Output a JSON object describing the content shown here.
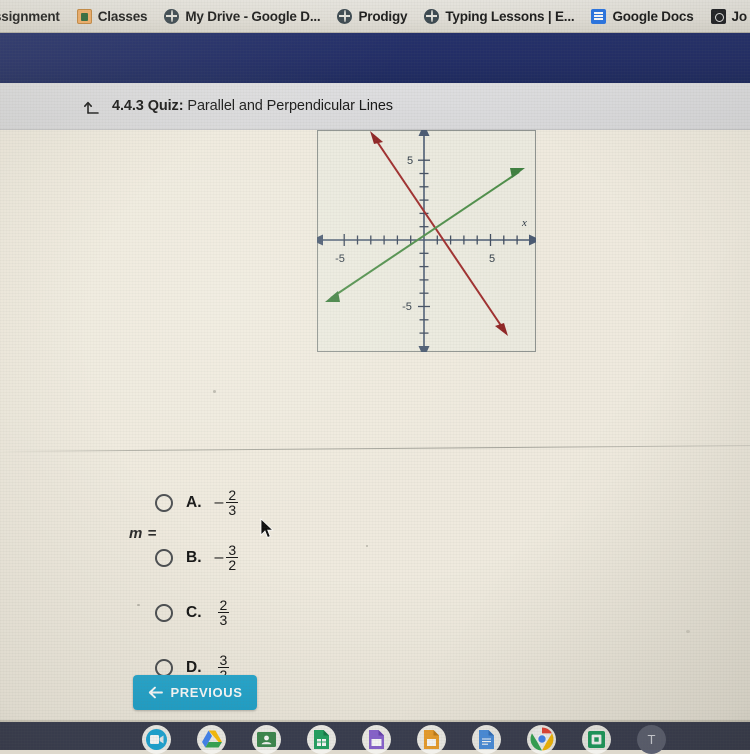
{
  "browser": {
    "bookmarks": [
      {
        "label": "ssignment",
        "icon": "none-icon",
        "truncated": true
      },
      {
        "label": "Classes",
        "icon": "google-classroom-icon"
      },
      {
        "label": "My Drive - Google D...",
        "icon": "globe-icon"
      },
      {
        "label": "Prodigy",
        "icon": "globe-icon"
      },
      {
        "label": "Typing Lessons | E...",
        "icon": "globe-icon"
      },
      {
        "label": "Google Docs",
        "icon": "google-docs-icon"
      },
      {
        "label": "Jo",
        "icon": "dark-app-icon",
        "truncated": true
      }
    ]
  },
  "quiz_header": {
    "back_icon": "back-up-arrow-icon",
    "number": "4.4.3",
    "kind": "Quiz:",
    "title": "Parallel and Perpendicular Lines"
  },
  "question": {
    "prompt": "m =",
    "figure": {
      "axis_label_x": "x",
      "x_ticks": [
        "-5",
        "5"
      ],
      "y_ticks": [
        "5",
        "-5"
      ],
      "lines": [
        {
          "name": "red-line",
          "color": "#9e2b2b",
          "slope": "negative",
          "arrows": "both"
        },
        {
          "name": "green-line",
          "color": "#4f8f4a",
          "slope": "positive",
          "arrows": "both"
        }
      ]
    },
    "choices": [
      {
        "letter": "A.",
        "sign": "–",
        "numerator": "2",
        "denominator": "3",
        "selected": false
      },
      {
        "letter": "B.",
        "sign": "–",
        "numerator": "3",
        "denominator": "2",
        "selected": false
      },
      {
        "letter": "C.",
        "sign": "",
        "numerator": "2",
        "denominator": "3",
        "selected": false
      },
      {
        "letter": "D.",
        "sign": "",
        "numerator": "3",
        "denominator": "2",
        "selected": false
      }
    ]
  },
  "footer": {
    "previous_label": "PREVIOUS",
    "previous_icon": "arrow-left-icon",
    "previous_color": "#23a5cd"
  },
  "shelf": {
    "icons": [
      "google-meet-icon",
      "google-drive-icon",
      "google-classroom-icon",
      "google-sheets-icon",
      "google-slides-icon",
      "google-keep-icon",
      "google-docs-icon",
      "chrome-icon",
      "calculator-icon"
    ],
    "avatar_letter": "T"
  },
  "chart_data": {
    "type": "line",
    "title": "",
    "xlabel": "x",
    "ylabel": "",
    "xlim": [
      -8,
      8
    ],
    "ylim": [
      -8,
      8
    ],
    "grid": false,
    "xticks": [
      -5,
      5
    ],
    "yticks": [
      -5,
      5
    ],
    "series": [
      {
        "name": "red-line",
        "color": "#9e2b2b",
        "slope": -1.5,
        "intercept": 0,
        "points": [
          [
            -4.6,
            6.9
          ],
          [
            4.6,
            -6.9
          ]
        ]
      },
      {
        "name": "green-line",
        "color": "#4f8f4a",
        "slope": 0.6667,
        "intercept": 0,
        "points": [
          [
            -6.6,
            -4.4
          ],
          [
            6.6,
            4.4
          ]
        ]
      }
    ]
  }
}
